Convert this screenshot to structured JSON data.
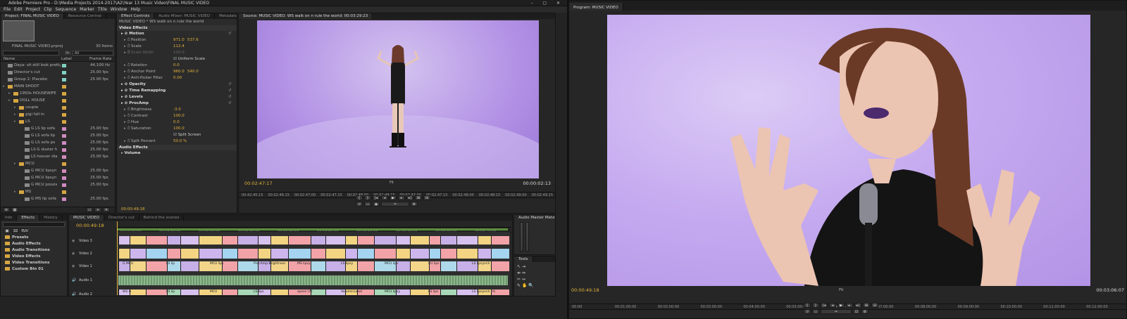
{
  "app": {
    "title": "Adobe Premiere Pro - D:\\Media Projects 2014-2017\\A2\\Year 13 Music Video\\FINAL MUSIC VIDEO",
    "window_buttons": "– ▢ ✕",
    "menu": [
      "File",
      "Edit",
      "Project",
      "Clip",
      "Sequence",
      "Marker",
      "Title",
      "Window",
      "Help"
    ]
  },
  "project_panel": {
    "tabs": [
      "Project: FINAL MUSIC VIDEO",
      "Resource Central"
    ],
    "filename": "FINAL MUSIC VIDEO.prproj",
    "item_count": "30 Items",
    "in_label": "In:",
    "in_value": "All",
    "columns": [
      "Name",
      "Label",
      "Frame Rate"
    ],
    "items": [
      {
        "name": "Daya- sit still look pretty (",
        "rate": "44,100 Hz",
        "color": "#7fd1c0",
        "type": "clip",
        "indent": 0
      },
      {
        "name": "Director's cut",
        "rate": "25.00 fps",
        "color": "#7fd1c0",
        "type": "clip",
        "indent": 0
      },
      {
        "name": "Group 2: Placebo",
        "rate": "25.00 fps",
        "color": "#7fd1c0",
        "type": "clip",
        "indent": 0
      },
      {
        "name": "MAIN SHOOT",
        "rate": "",
        "color": "#d6a641",
        "type": "folder",
        "indent": 0
      },
      {
        "name": "1950s HOUSEWIFE",
        "rate": "",
        "color": "#d6a641",
        "type": "folder",
        "indent": 1
      },
      {
        "name": "DOLL HOUSE",
        "rate": "",
        "color": "#d6a641",
        "type": "folder",
        "indent": 1
      },
      {
        "name": "couple",
        "rate": "",
        "color": "#d6a641",
        "type": "folder",
        "indent": 2
      },
      {
        "name": "gigi fall in",
        "rate": "",
        "color": "#d6a641",
        "type": "folder",
        "indent": 2
      },
      {
        "name": "LS",
        "rate": "",
        "color": "#d6a641",
        "type": "folder",
        "indent": 2
      },
      {
        "name": "G LS lip sofa",
        "rate": "25.00 fps",
        "color": "#d08ac0",
        "type": "clip",
        "indent": 3
      },
      {
        "name": "G LS sofa lip",
        "rate": "25.00 fps",
        "color": "#d08ac0",
        "type": "clip",
        "indent": 3
      },
      {
        "name": "G LS sofa po",
        "rate": "25.00 fps",
        "color": "#d08ac0",
        "type": "clip",
        "indent": 3
      },
      {
        "name": "LS G duster h",
        "rate": "25.00 fps",
        "color": "#d08ac0",
        "type": "clip",
        "indent": 3
      },
      {
        "name": "LS hoover dia",
        "rate": "25.00 fps",
        "color": "#d08ac0",
        "type": "clip",
        "indent": 3
      },
      {
        "name": "MCU",
        "rate": "",
        "color": "#d6a641",
        "type": "folder",
        "indent": 2
      },
      {
        "name": "G MCU lipsyn",
        "rate": "25.00 fps",
        "color": "#d08ac0",
        "type": "clip",
        "indent": 3
      },
      {
        "name": "G MCU lipsyn",
        "rate": "25.00 fps",
        "color": "#d08ac0",
        "type": "clip",
        "indent": 3
      },
      {
        "name": "G MCU possis",
        "rate": "25.00 fps",
        "color": "#d08ac0",
        "type": "clip",
        "indent": 3
      },
      {
        "name": "MS",
        "rate": "",
        "color": "#d6a641",
        "type": "folder",
        "indent": 2
      },
      {
        "name": "G MS lip sofa",
        "rate": "25.00 fps",
        "color": "#d08ac0",
        "type": "clip",
        "indent": 3
      }
    ]
  },
  "effect_controls": {
    "tabs": [
      "Effect Controls",
      "Audio Mixer: MUSIC VIDEO",
      "Metadata"
    ],
    "clip": "MUSIC VIDEO * WS walk on n rule the world",
    "video_effects": "Video Effects",
    "rows": [
      {
        "label": "Motion",
        "value": "",
        "bold": true
      },
      {
        "label": "Position",
        "value": "971.0",
        "value2": "537.6"
      },
      {
        "label": "Scale",
        "value": "112.4"
      },
      {
        "label": "Scale Width",
        "value": "100.0",
        "dim": true
      },
      {
        "label": "",
        "value": "Uniform Scale",
        "check": true
      },
      {
        "label": "Rotation",
        "value": "0.0"
      },
      {
        "label": "Anchor Point",
        "value": "960.0",
        "value2": "540.0"
      },
      {
        "label": "Anti-flicker Filter",
        "value": "0.00"
      },
      {
        "label": "Opacity",
        "value": "",
        "bold": true
      },
      {
        "label": "Time Remapping",
        "value": "",
        "bold": true
      },
      {
        "label": "Levels",
        "value": "",
        "bold": true
      },
      {
        "label": "ProcAmp",
        "value": "",
        "bold": true
      },
      {
        "label": "Brightness",
        "value": "-3.0"
      },
      {
        "label": "Contrast",
        "value": "100.0"
      },
      {
        "label": "Hue",
        "value": "0.0"
      },
      {
        "label": "Saturation",
        "value": "100.0"
      },
      {
        "label": "",
        "value": "Split Screen",
        "check": true
      },
      {
        "label": "Split Percent",
        "value": "50.0 %"
      }
    ],
    "audio_effects": "Audio Effects",
    "volume": "Volume",
    "timecode": "00:00:49:18"
  },
  "source_monitor": {
    "tab": "Source: MUSIC VIDEO: WS walk on n rule the world: 00:03:29:23",
    "timecode_in": "00:02:47:17",
    "timecode_dur": "00:00:02:13",
    "ruler": [
      "00:42:45:15",
      "00:02:46:15",
      "00:02:47:00",
      "00:02:47:15",
      "00:02:48:00",
      "00:02:48:15",
      "00:02:47:00",
      "00:02:47:15",
      "00:02:48:00",
      "00:02:48:15",
      "00:02:49:00",
      "00:02:49:15"
    ],
    "zoom": "Fit"
  },
  "effects_panel": {
    "tabs": [
      "Info",
      "Effects",
      "History"
    ],
    "items": [
      "Presets",
      "Audio Effects",
      "Audio Transitions",
      "Video Effects",
      "Video Transitions",
      "Custom Bin 01"
    ]
  },
  "timeline": {
    "tabs": [
      "MUSIC VIDEO",
      "Director's cut",
      "Behind the scenes"
    ],
    "timecode": "00:00:49:18",
    "ruler": [
      "00:00:55:00",
      "00:01:00:00",
      "00:01:05:00",
      "00:01:10:00",
      "00:01:15:00",
      "00:01:20:00",
      "00:01:25:00",
      "00:01:30:00",
      "00:01:35:00",
      "00:01:40:00"
    ],
    "tracks": [
      "Video 3",
      "Video 2",
      "Video 1",
      "Audio 1",
      "Audio 2"
    ],
    "v1_clip_labels": [
      "G MCU",
      "LS lip",
      "MCU lips",
      "ProcAmp:Brightness",
      "MS lipsy",
      "LS lipsy",
      "MCU lips",
      "CU lips",
      "LS lipsynch"
    ],
    "a2_clip_labels": [
      "WS G",
      "LS lip",
      "MCU",
      "LS lips",
      "spoon (A)",
      "Volume:Level",
      "MCU lipsy",
      "LS lips",
      "LS lipsynch (A)"
    ]
  },
  "audio_meters": {
    "tab": "Audio Master Meters"
  },
  "tools": {
    "tab": "Tools"
  },
  "program_monitor": {
    "tab": "Program: MUSIC VIDEO",
    "timecode": "00:00:49:18",
    "duration": "00:03:06:07",
    "zoom": "Fit",
    "ruler": [
      "00:00",
      "00:01:00:00",
      "00:02:00:00",
      "00:03:00:00",
      "00:04:00:00",
      "00:05:00:00",
      "00:06:00:00",
      "00:07:00:00",
      "00:08:00:00",
      "00:09:00:00",
      "00:10:00:00",
      "00:11:00:00",
      "00:12:00:00"
    ]
  },
  "colors": {
    "accent": "#e3b33b",
    "bg": "#232323",
    "panel": "#2b2b2b",
    "violet": "#c5aaf0"
  }
}
